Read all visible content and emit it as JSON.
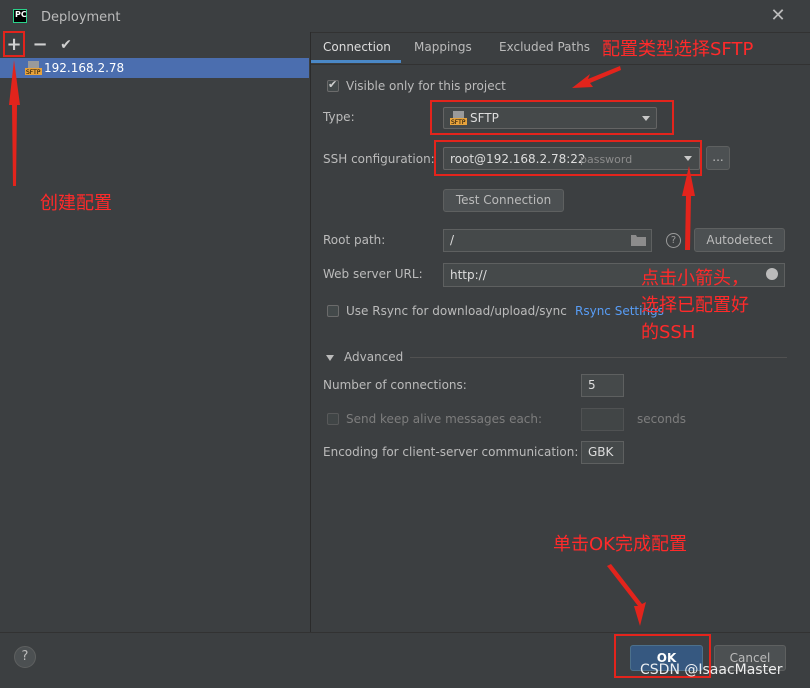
{
  "window": {
    "title": "Deployment",
    "logo_text": "PC"
  },
  "left": {
    "toolbar": {
      "add": "+",
      "remove": "−",
      "apply": "✔"
    },
    "servers": [
      {
        "icon": "sftp-server-icon",
        "label": "192.168.2.78"
      }
    ]
  },
  "tabs": [
    "Connection",
    "Mappings",
    "Excluded Paths"
  ],
  "connection": {
    "visible_only_label": "Visible only for this project",
    "type_label": "Type:",
    "type_value": "SFTP",
    "ssh_label": "SSH configuration:",
    "ssh_value": "root@192.168.2.78:22",
    "ssh_hint": "password",
    "ssh_more": "...",
    "test_button": "Test Connection",
    "root_path_label": "Root path:",
    "root_path_value": "/",
    "autodetect_button": "Autodetect",
    "web_url_label": "Web server URL:",
    "web_url_value": "http://",
    "rsync_label": "Use Rsync for download/upload/sync",
    "rsync_link": "Rsync Settings",
    "advanced_label": "Advanced",
    "num_conn_label": "Number of connections:",
    "num_conn_value": "5",
    "keepalive_label": "Send keep alive messages each:",
    "keepalive_unit": "seconds",
    "encoding_label": "Encoding for client-server communication:",
    "encoding_value": "GBK"
  },
  "footer": {
    "help": "?",
    "ok": "OK",
    "cancel": "Cancel"
  },
  "annotations": {
    "create_config": "创建配置",
    "choose_sftp": "配置类型选择SFTP",
    "click_arrow_1": "点击小箭头，",
    "click_arrow_2": "选择已配置好",
    "click_arrow_3": "的SSH",
    "click_ok": "单击OK完成配置"
  },
  "watermark": "CSDN @IsaacMaster",
  "colors": {
    "background": "#3c3f41",
    "selection": "#4b6eaf",
    "ok_button": "#365880",
    "annotation": "#ff2a2a"
  }
}
